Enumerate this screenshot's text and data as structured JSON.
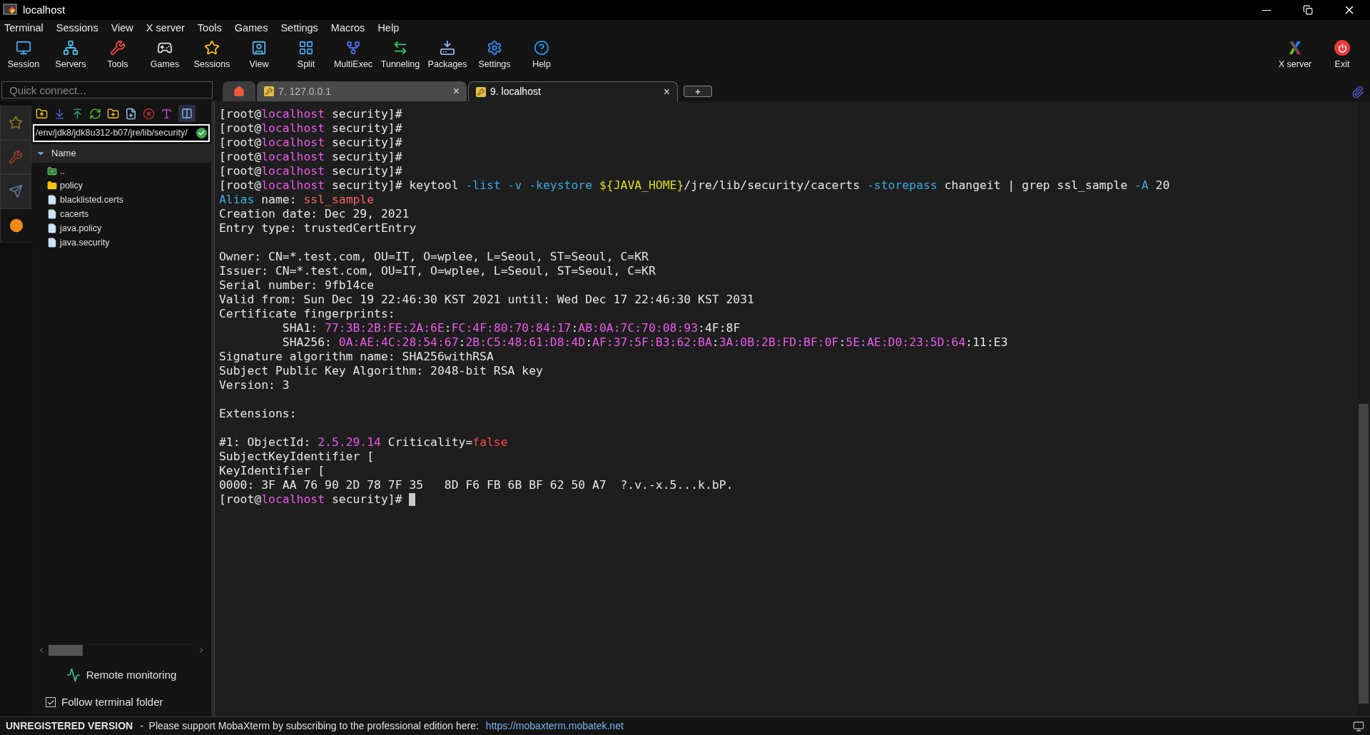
{
  "window": {
    "title": "localhost"
  },
  "menu": [
    "Terminal",
    "Sessions",
    "View",
    "X server",
    "Tools",
    "Games",
    "Settings",
    "Macros",
    "Help"
  ],
  "toolbar": [
    {
      "label": "Session"
    },
    {
      "label": "Servers"
    },
    {
      "label": "Tools"
    },
    {
      "label": "Games"
    },
    {
      "label": "Sessions"
    },
    {
      "label": "View"
    },
    {
      "label": "Split"
    },
    {
      "label": "MultiExec"
    },
    {
      "label": "Tunneling"
    },
    {
      "label": "Packages"
    },
    {
      "label": "Settings"
    },
    {
      "label": "Help"
    }
  ],
  "toolbar_right": [
    {
      "label": "X server",
      "kind": "xserver"
    },
    {
      "label": "Exit",
      "kind": "exit"
    }
  ],
  "quick_connect": {
    "placeholder": "Quick connect..."
  },
  "tabs": [
    {
      "kind": "home",
      "selected": false
    },
    {
      "kind": "session",
      "label": "7. 127.0.0.1",
      "selected": false,
      "close": "×"
    },
    {
      "kind": "session",
      "label": "9. localhost",
      "selected": true,
      "close": "×"
    },
    {
      "kind": "new",
      "label": "+",
      "selected": false
    }
  ],
  "side_tabs": [
    {
      "selected": false
    },
    {
      "selected": false
    },
    {
      "selected": false
    },
    {
      "selected": true
    }
  ],
  "sftp": {
    "path": "/env/jdk8/jdk8u312-b07/jre/lib/security/",
    "column": "Name",
    "files": [
      {
        "name": "..",
        "kind": "up"
      },
      {
        "name": "policy",
        "kind": "folder"
      },
      {
        "name": "blacklisted.certs",
        "kind": "file"
      },
      {
        "name": "cacerts",
        "kind": "file"
      },
      {
        "name": "java.policy",
        "kind": "file"
      },
      {
        "name": "java.security",
        "kind": "file"
      }
    ],
    "remote_monitoring": "Remote monitoring",
    "follow_folder": {
      "label": "Follow terminal folder",
      "checked": true
    }
  },
  "terminal": {
    "cursor_visible": true,
    "blocks": [
      {
        "lines": [
          {
            "segments": [
              {
                "text": "[root@",
                "color": "#e6e6e6"
              },
              {
                "text": "localhost",
                "color": "#e85ae8"
              },
              {
                "text": " security]#",
                "color": "#e6e6e6"
              }
            ]
          },
          {
            "segments": [
              {
                "text": "[root@",
                "color": "#e6e6e6"
              },
              {
                "text": "localhost",
                "color": "#e85ae8"
              },
              {
                "text": " security]#",
                "color": "#e6e6e6"
              }
            ]
          },
          {
            "segments": [
              {
                "text": "[root@",
                "color": "#e6e6e6"
              },
              {
                "text": "localhost",
                "color": "#e85ae8"
              },
              {
                "text": " security]#",
                "color": "#e6e6e6"
              }
            ]
          },
          {
            "segments": [
              {
                "text": "[root@",
                "color": "#e6e6e6"
              },
              {
                "text": "localhost",
                "color": "#e85ae8"
              },
              {
                "text": " security]#",
                "color": "#e6e6e6"
              }
            ]
          },
          {
            "segments": [
              {
                "text": "[root@",
                "color": "#e6e6e6"
              },
              {
                "text": "localhost",
                "color": "#e85ae8"
              },
              {
                "text": " security]#",
                "color": "#e6e6e6"
              }
            ]
          },
          {
            "segments": [
              {
                "text": "[root@",
                "color": "#e6e6e6"
              },
              {
                "text": "localhost",
                "color": "#e85ae8"
              },
              {
                "text": " security]# keytool ",
                "color": "#e6e6e6"
              },
              {
                "text": "-list -v -keystore ",
                "color": "#3ca8dc"
              },
              {
                "text": "${JAVA_HOME}",
                "color": "#dcdc28"
              },
              {
                "text": "/jre/lib/security/cacerts ",
                "color": "#e6e6e6"
              },
              {
                "text": "-storepass",
                "color": "#3ca8dc"
              },
              {
                "text": " changeit | grep ssl_sample ",
                "color": "#e6e6e6"
              },
              {
                "text": "-A",
                "color": "#3ca8dc"
              },
              {
                "text": " 20",
                "color": "#e6e6e6"
              }
            ]
          },
          {
            "segments": [
              {
                "text": "Alias",
                "color": "#3ca8dc"
              },
              {
                "text": " name: ",
                "color": "#e6e6e6"
              },
              {
                "text": "ssl_sample",
                "color": "#f06464"
              }
            ]
          },
          {
            "segments": [
              {
                "text": "Creation date: Dec 29, 2021",
                "color": "#e6e6e6"
              }
            ]
          },
          {
            "segments": [
              {
                "text": "Entry type: trustedCertEntry",
                "color": "#e6e6e6"
              }
            ]
          }
        ]
      },
      {
        "lines": [
          {
            "segments": [
              {
                "text": "Owner: CN=*.test.com, OU=IT, O=wplee, L=Seoul, ST=Seoul, C=KR",
                "color": "#e6e6e6"
              }
            ]
          },
          {
            "segments": [
              {
                "text": "Issuer: CN=*.test.com, OU=IT, O=wplee, L=Seoul, ST=Seoul, C=KR",
                "color": "#e6e6e6"
              }
            ]
          },
          {
            "segments": [
              {
                "text": "Serial number: 9fb14ce",
                "color": "#e6e6e6"
              }
            ]
          },
          {
            "segments": [
              {
                "text": "Valid from: Sun Dec 19 22:46:30 KST 2021 until: Wed Dec 17 22:46:30 KST 2031",
                "color": "#e6e6e6"
              }
            ]
          },
          {
            "segments": [
              {
                "text": "Certificate fingerprints:",
                "color": "#e6e6e6"
              }
            ]
          },
          {
            "segments": [
              {
                "text": "         SHA1: ",
                "color": "#e6e6e6"
              },
              {
                "text": "77:3B:2B:FE:2A:6E",
                "color": "#e85ae8"
              },
              {
                "text": ":",
                "color": "#e6e6e6"
              },
              {
                "text": "FC:4F:80:70:84:17",
                "color": "#e85ae8"
              },
              {
                "text": ":",
                "color": "#e6e6e6"
              },
              {
                "text": "AB:0A:7C:70:08:93",
                "color": "#e85ae8"
              },
              {
                "text": ":4F:8F",
                "color": "#e6e6e6"
              }
            ]
          },
          {
            "segments": [
              {
                "text": "         SHA256: ",
                "color": "#e6e6e6"
              },
              {
                "text": "0A:AE:4C:28:54:67",
                "color": "#e85ae8"
              },
              {
                "text": ":",
                "color": "#e6e6e6"
              },
              {
                "text": "2B:C5:48:61:D8:4D",
                "color": "#e85ae8"
              },
              {
                "text": ":",
                "color": "#e6e6e6"
              },
              {
                "text": "AF:37:5F:B3:62:BA",
                "color": "#e85ae8"
              },
              {
                "text": ":",
                "color": "#e6e6e6"
              },
              {
                "text": "3A:0B:2B:FD:BF:0F",
                "color": "#e85ae8"
              },
              {
                "text": ":",
                "color": "#e6e6e6"
              },
              {
                "text": "5E:AE:D0:23:5D:64",
                "color": "#e85ae8"
              },
              {
                "text": ":11:E3",
                "color": "#e6e6e6"
              }
            ]
          },
          {
            "segments": [
              {
                "text": "Signature algorithm name: SHA256withRSA",
                "color": "#e6e6e6"
              }
            ]
          },
          {
            "segments": [
              {
                "text": "Subject Public Key Algorithm: 2048-bit RSA key",
                "color": "#e6e6e6"
              }
            ]
          },
          {
            "segments": [
              {
                "text": "Version: 3",
                "color": "#e6e6e6"
              }
            ]
          }
        ]
      },
      {
        "lines": [
          {
            "segments": [
              {
                "text": "Extensions:",
                "color": "#e6e6e6"
              }
            ]
          }
        ]
      },
      {
        "lines": [
          {
            "segments": [
              {
                "text": "#1: ObjectId: ",
                "color": "#e6e6e6"
              },
              {
                "text": "2.5.29.14",
                "color": "#e85ae8"
              },
              {
                "text": " Criticality=",
                "color": "#e6e6e6"
              },
              {
                "text": "false",
                "color": "#f04848"
              }
            ]
          },
          {
            "segments": [
              {
                "text": "SubjectKeyIdentifier [",
                "color": "#e6e6e6"
              }
            ]
          },
          {
            "segments": [
              {
                "text": "KeyIdentifier [",
                "color": "#e6e6e6"
              }
            ]
          },
          {
            "segments": [
              {
                "text": "0000: 3F AA 76 90 2D 78 7F 35   8D F6 FB 6B BF 62 50 A7  ?.v.-x.5...k.bP.",
                "color": "#e6e6e6"
              }
            ]
          },
          {
            "segments": [
              {
                "text": "[root@",
                "color": "#e6e6e6"
              },
              {
                "text": "localhost",
                "color": "#e85ae8"
              },
              {
                "text": " security]# ",
                "color": "#e6e6e6"
              }
            ]
          }
        ]
      }
    ]
  },
  "status_bar": {
    "title": "UNREGISTERED VERSION",
    "message": "-  Please support MobaXterm by subscribing to the professional edition here:",
    "link": "https://mobaxterm.mobatek.net"
  }
}
